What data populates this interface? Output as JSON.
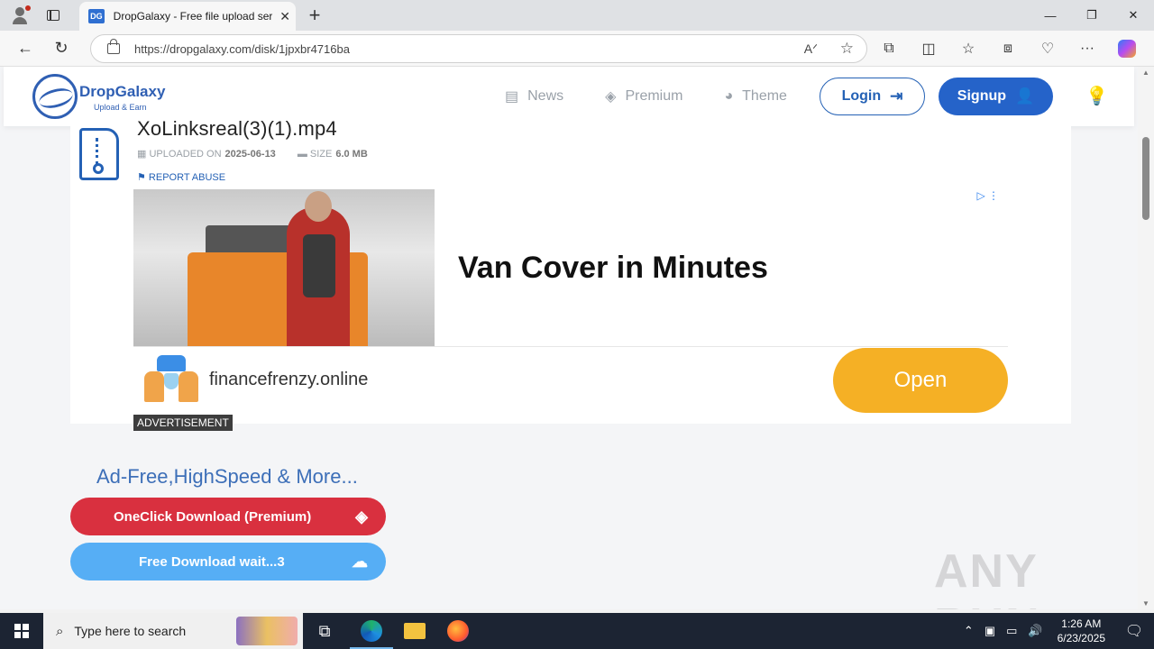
{
  "browser": {
    "tab_title": "DropGalaxy - Free file upload serv",
    "tab_favicon_text": "DG",
    "url": "https://dropgalaxy.com/disk/1jpxbr4716ba"
  },
  "site": {
    "logo_name": "DropGalaxy",
    "logo_tagline": "Upload & Earn",
    "nav": [
      {
        "label": "News",
        "icon": "newspaper-icon"
      },
      {
        "label": "Premium",
        "icon": "diamond-icon"
      },
      {
        "label": "Theme",
        "icon": "palette-icon"
      }
    ],
    "login_label": "Login",
    "signup_label": "Signup"
  },
  "file": {
    "name": "XoLinksreal(3)(1).mp4",
    "uploaded_prefix": "UPLOADED ON",
    "uploaded_date": "2025-06-13",
    "size_prefix": "SIZE",
    "size_value": "6.0 MB",
    "report_label": "REPORT ABUSE"
  },
  "ad": {
    "headline": "Van Cover in Minutes",
    "domain": "financefrenzy.online",
    "cta": "Open",
    "label": "ADVERTISEMENT"
  },
  "downloads": {
    "heading": "Ad-Free,HighSpeed & More...",
    "premium_label": "OneClick Download (Premium)",
    "free_label": "Free Download wait...3"
  },
  "watermark": "ANY RUN",
  "taskbar": {
    "search_placeholder": "Type here to search",
    "time": "1:26 AM",
    "date": "6/23/2025"
  },
  "colors": {
    "brand_blue": "#2461b5",
    "premium_red": "#d9303f",
    "free_blue": "#56aef5",
    "ad_cta": "#f5b025"
  }
}
